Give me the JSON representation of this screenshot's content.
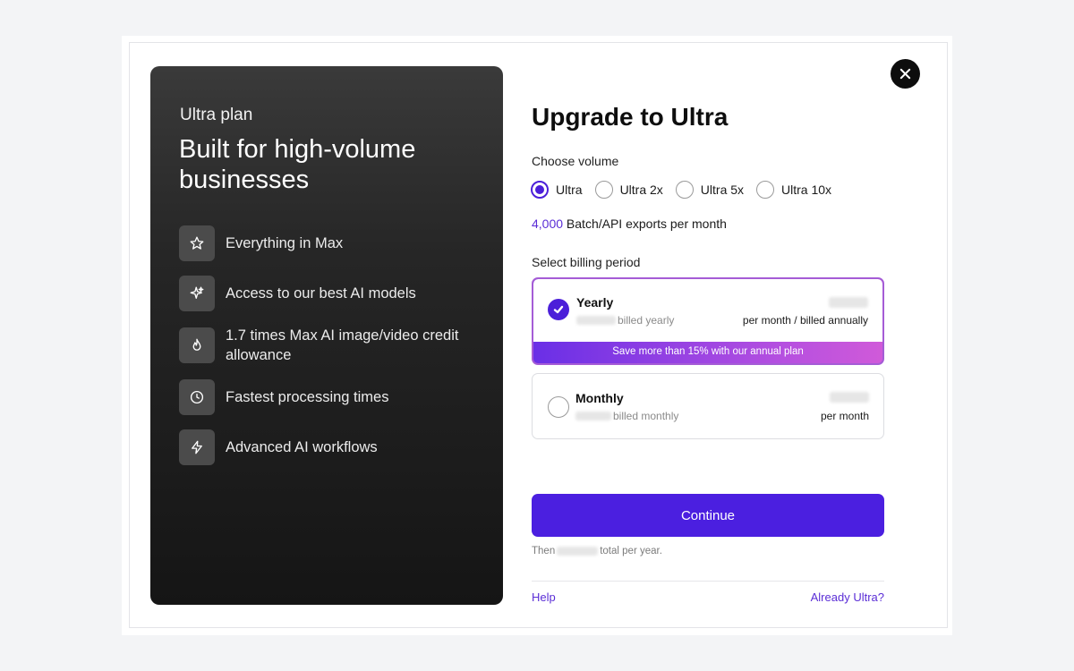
{
  "left_panel": {
    "plan_name": "Ultra plan",
    "headline": "Built for high-volume businesses",
    "features": [
      {
        "icon": "star-icon",
        "text": "Everything in Max"
      },
      {
        "icon": "sparkle-icon",
        "text": "Access to our best AI models"
      },
      {
        "icon": "flame-icon",
        "text": "1.7 times Max AI image/video credit allowance"
      },
      {
        "icon": "clock-icon",
        "text": "Fastest processing times"
      },
      {
        "icon": "lightning-icon",
        "text": "Advanced AI workflows"
      }
    ]
  },
  "dialog": {
    "title": "Upgrade to Ultra",
    "close_icon": "close-icon"
  },
  "volume": {
    "label": "Choose volume",
    "options": [
      "Ultra",
      "Ultra 2x",
      "Ultra 5x",
      "Ultra 10x"
    ],
    "selected": "Ultra",
    "exports_count": "4,000",
    "exports_text": " Batch/API exports per month"
  },
  "billing": {
    "label": "Select billing period",
    "yearly": {
      "name": "Yearly",
      "billed": "billed yearly",
      "per": "per month / billed annually",
      "banner": "Save more than 15% with our annual plan",
      "selected": true
    },
    "monthly": {
      "name": "Monthly",
      "billed": "billed monthly",
      "per": "per month",
      "selected": false
    }
  },
  "actions": {
    "continue_label": "Continue",
    "then_prefix": "Then",
    "then_suffix": "total per year.",
    "help_label": "Help",
    "already_label": "Already Ultra?"
  },
  "colors": {
    "accent": "#4b1fe0",
    "link": "#5a2dd6",
    "banner_start": "#6a2fe6",
    "banner_end": "#d05ad9"
  }
}
